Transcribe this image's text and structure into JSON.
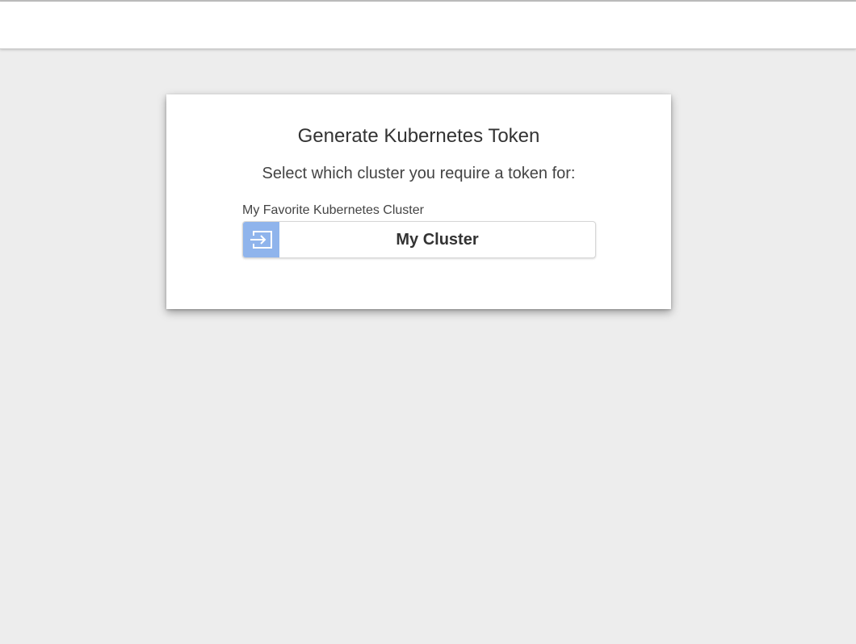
{
  "card": {
    "title": "Generate Kubernetes Token",
    "subtitle": "Select which cluster you require a token for:"
  },
  "clusters": [
    {
      "label": "My Favorite Kubernetes Cluster",
      "button_label": "My Cluster",
      "icon": "login-icon"
    }
  ],
  "colors": {
    "background": "#ededed",
    "icon_accent": "#8fb4ec"
  }
}
